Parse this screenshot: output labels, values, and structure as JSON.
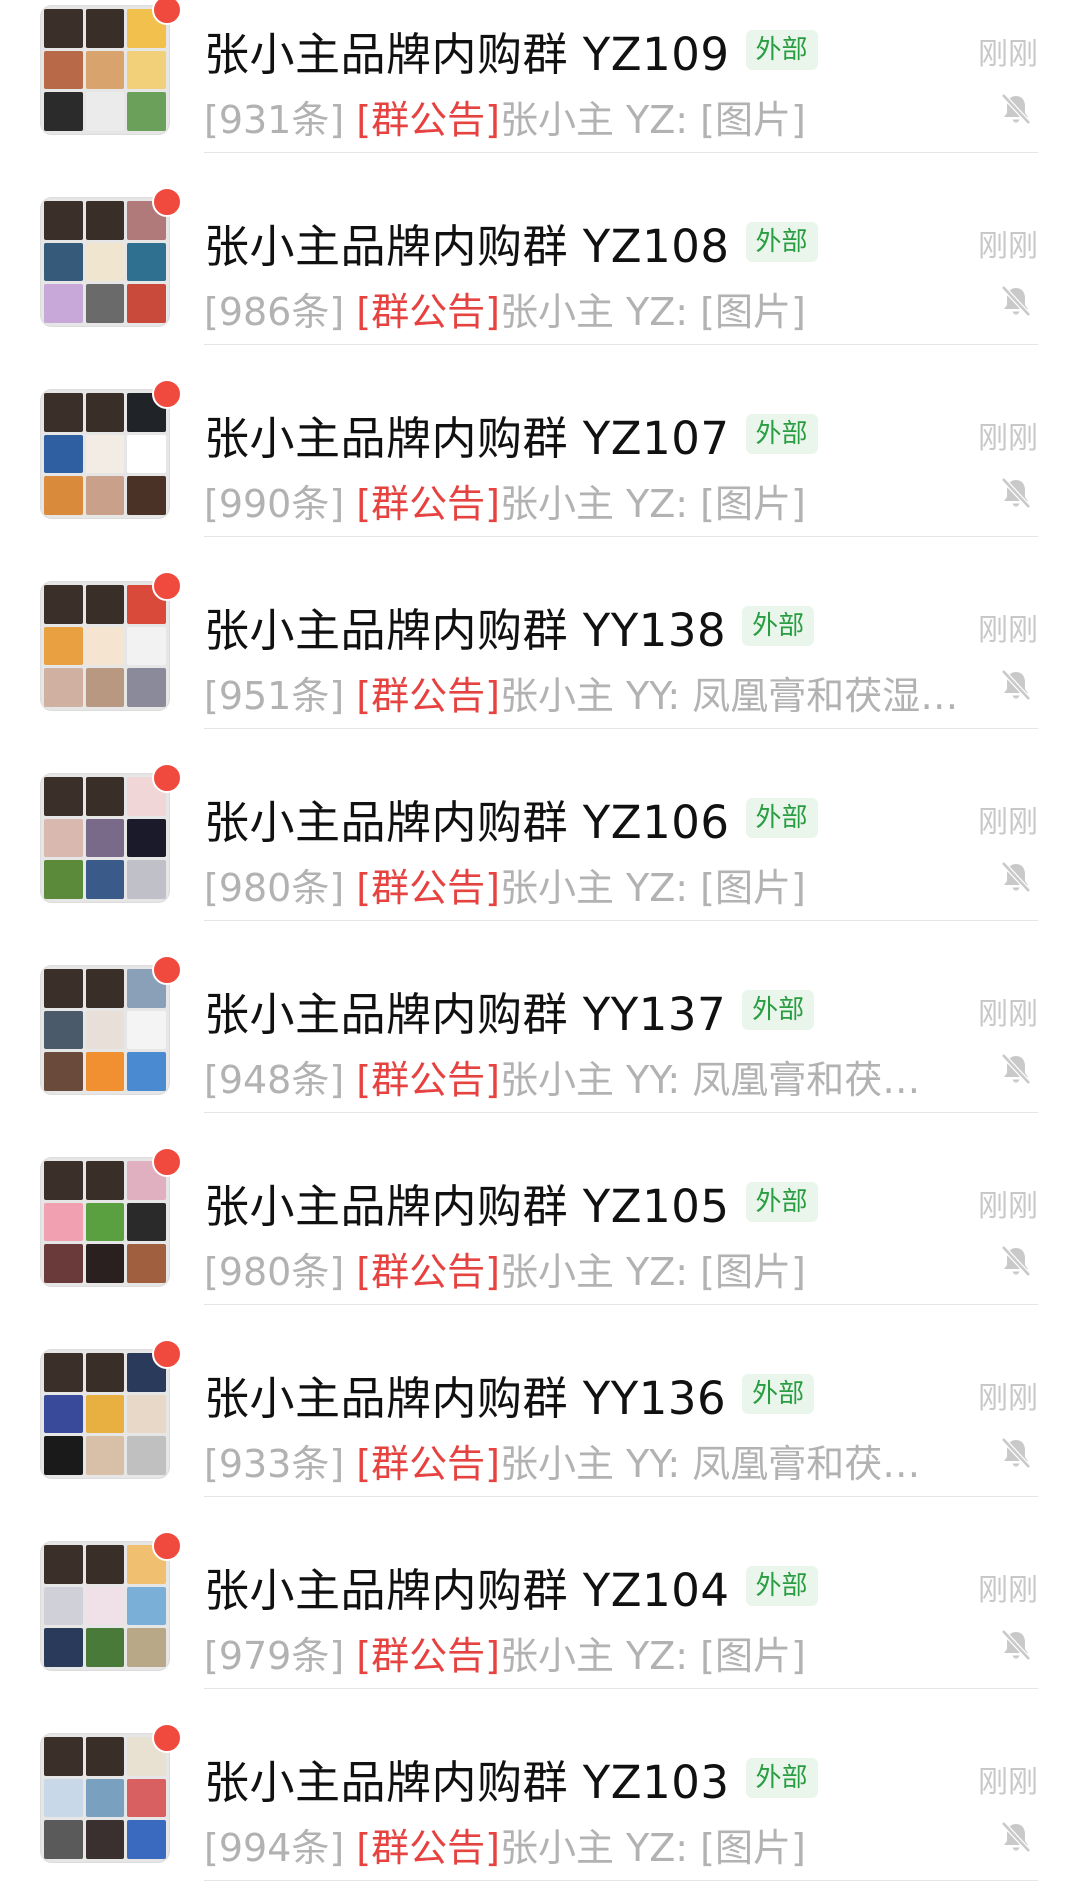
{
  "colors": {
    "badge": "#f04a3e",
    "notice": "#e64340",
    "external_tag": "#2a9d43",
    "preview_text": "#b2b2b2",
    "time_text": "#c8c8c8"
  },
  "chats": [
    {
      "title": "张小主品牌内购群 YZ109",
      "tag": "外部",
      "time": "刚刚",
      "count": "[931条]",
      "notice": "[群公告]",
      "message": "张小主 YZ: [图片]",
      "muted": true,
      "unread_dot": true,
      "tiles": [
        "#3b2f2a",
        "#3a2e28",
        "#f2c04c",
        "#b86a48",
        "#d8a36d",
        "#f2d07a",
        "#2b2b2b",
        "#ebebeb",
        "#6ba05a"
      ]
    },
    {
      "title": "张小主品牌内购群 YZ108",
      "tag": "外部",
      "time": "刚刚",
      "count": "[986条]",
      "notice": "[群公告]",
      "message": "张小主 YZ: [图片]",
      "muted": true,
      "unread_dot": true,
      "tiles": [
        "#3b2f2a",
        "#3a2e28",
        "#b07a7a",
        "#355a7a",
        "#f0e6cf",
        "#2f6f8f",
        "#c8a8d8",
        "#6a6a6a",
        "#c94a3a"
      ]
    },
    {
      "title": "张小主品牌内购群 YZ107",
      "tag": "外部",
      "time": "刚刚",
      "count": "[990条]",
      "notice": "[群公告]",
      "message": "张小主 YZ: [图片]",
      "muted": true,
      "unread_dot": true,
      "tiles": [
        "#3b2f2a",
        "#3a2e28",
        "#202428",
        "#2f5fa0",
        "#f3ece4",
        "#ffffff",
        "#d98a3a",
        "#c9a08a",
        "#4a3326"
      ]
    },
    {
      "title": "张小主品牌内购群 YY138",
      "tag": "外部",
      "time": "刚刚",
      "count": "[951条]",
      "notice": "[群公告]",
      "message": "张小主 YY: 凤凰膏和茯湿…",
      "muted": true,
      "unread_dot": true,
      "tiles": [
        "#3b2f2a",
        "#3a2e28",
        "#d94a3a",
        "#e8a040",
        "#f5e4d0",
        "#f2f2f2",
        "#d0b0a0",
        "#b89880",
        "#8a8a9a"
      ]
    },
    {
      "title": "张小主品牌内购群 YZ106",
      "tag": "外部",
      "time": "刚刚",
      "count": "[980条]",
      "notice": "[群公告]",
      "message": "张小主 YZ: [图片]",
      "muted": true,
      "unread_dot": true,
      "tiles": [
        "#3b2f2a",
        "#3a2e28",
        "#f0d6d6",
        "#d9b8b0",
        "#7a6a8a",
        "#1a1a2a",
        "#5a8a3a",
        "#3a5a8a",
        "#c0c0c8"
      ]
    },
    {
      "title": "张小主品牌内购群 YY137",
      "tag": "外部",
      "time": "刚刚",
      "count": "[948条]",
      "notice": "[群公告]",
      "message": "张小主 YY: 凤凰膏和茯…",
      "muted": true,
      "unread_dot": true,
      "tiles": [
        "#3b2f2a",
        "#3a2e28",
        "#8aa0b8",
        "#4a5a6a",
        "#e8e0d8",
        "#f4f4f4",
        "#6a4a3a",
        "#f09030",
        "#4a8ad0"
      ]
    },
    {
      "title": "张小主品牌内购群 YZ105",
      "tag": "外部",
      "time": "刚刚",
      "count": "[980条]",
      "notice": "[群公告]",
      "message": "张小主 YZ: [图片]",
      "muted": true,
      "unread_dot": true,
      "tiles": [
        "#3b2f2a",
        "#3a2e28",
        "#e0b0c0",
        "#f0a0b0",
        "#5aa040",
        "#2a2a2a",
        "#6a3a3a",
        "#2a2020",
        "#a06040"
      ]
    },
    {
      "title": "张小主品牌内购群 YY136",
      "tag": "外部",
      "time": "刚刚",
      "count": "[933条]",
      "notice": "[群公告]",
      "message": "张小主 YY: 凤凰膏和茯…",
      "muted": true,
      "unread_dot": true,
      "tiles": [
        "#3b2f2a",
        "#3a2e28",
        "#2a3a5a",
        "#3a4a9a",
        "#e8b040",
        "#e8d8c8",
        "#1a1a1a",
        "#d8c0a8",
        "#c0c0c0"
      ]
    },
    {
      "title": "张小主品牌内购群 YZ104",
      "tag": "外部",
      "time": "刚刚",
      "count": "[979条]",
      "notice": "[群公告]",
      "message": "张小主 YZ: [图片]",
      "muted": true,
      "unread_dot": true,
      "tiles": [
        "#3b2f2a",
        "#3a2e28",
        "#f0c070",
        "#d0d0d8",
        "#f0e0e8",
        "#7ab0d8",
        "#2a3a5a",
        "#4a7a3a",
        "#b8a888"
      ]
    },
    {
      "title": "张小主品牌内购群 YZ103",
      "tag": "外部",
      "time": "刚刚",
      "count": "[994条]",
      "notice": "[群公告]",
      "message": "张小主 YZ: [图片]",
      "muted": true,
      "unread_dot": true,
      "tiles": [
        "#3b2f2a",
        "#3a2e28",
        "#e8e0d0",
        "#c8d8e8",
        "#7aa0c0",
        "#d86060",
        "#5a5a5a",
        "#3a3030",
        "#3a6ac0"
      ]
    }
  ]
}
